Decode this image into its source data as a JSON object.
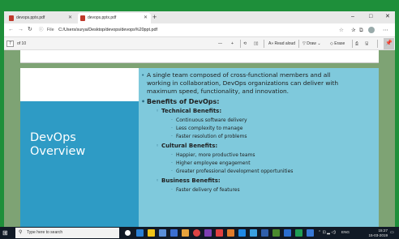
{
  "browser": {
    "tabs": [
      {
        "label": "devops.pptx.pdf",
        "active": false
      },
      {
        "label": "devops.pptx.pdf",
        "active": true
      }
    ],
    "new_tab": "+",
    "url_label": "File",
    "url": "C:/Users/surya/Desktop/devops/devops%20ppt.pdf"
  },
  "pdf_toolbar": {
    "page_current": "7",
    "page_total": "of 10",
    "zoom_out": "—",
    "zoom_in": "+",
    "read_aloud": "Read aloud",
    "draw": "Draw",
    "erase": "Erase"
  },
  "slide": {
    "title_lines": [
      "DevOps",
      "Overview"
    ],
    "intro_lines": [
      "A single team composed of cross-functional members and all",
      "working in collaboration, DevOps organizations can deliver with",
      "maximum speed, functionality, and innovation."
    ],
    "benefits_heading": "Benefits of DevOps:",
    "technical_heading": "Technical Benefits:",
    "technical_items": [
      "Continuous software delivery",
      "Less complexity to manage",
      "Faster resolution of problems"
    ],
    "cultural_heading": "Cultural Benefits:",
    "cultural_items": [
      "Happier, more productive teams",
      "Higher employee engagement",
      "Greater professional development opportunities"
    ],
    "business_heading": "Business Benefits:",
    "business_items": [
      "Faster delivery of features"
    ]
  },
  "taskbar": {
    "search_placeholder": "Type here to search",
    "language": "ENG",
    "time": "15:27",
    "date": "15-03-2019"
  },
  "colors": {
    "desktop": "#1e8f3a",
    "viewer_background": "#7ea374",
    "slide_title_panel": "#2e9bc5",
    "slide_content_panel": "#7fc9dc"
  }
}
